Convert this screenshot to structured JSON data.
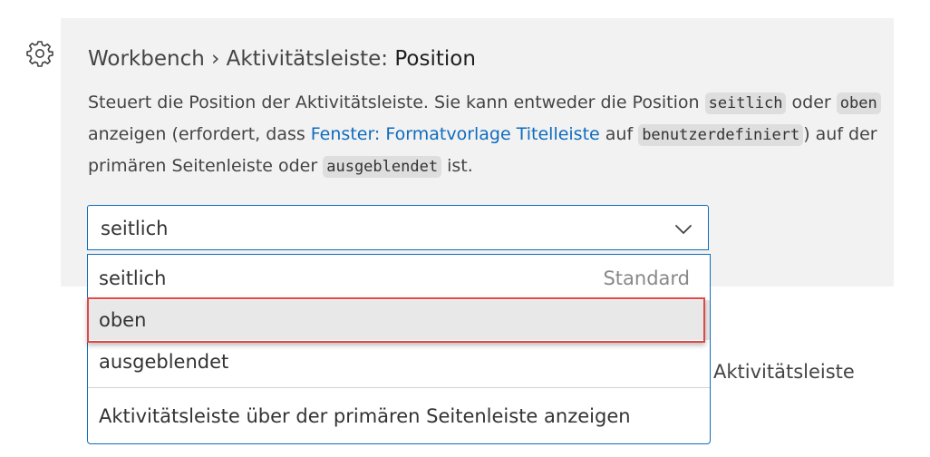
{
  "setting": {
    "category": "Workbench › Aktivitätsleiste: ",
    "name": "Position",
    "description": {
      "part1": "Steuert die Position der Aktivitätsleiste. Sie kann entweder die Position ",
      "code1": "seitlich",
      "part2": " oder ",
      "code2": "oben",
      "part3": " anzeigen (erfordert, dass ",
      "link": "Fenster: Formatvorlage Titelleiste",
      "part4": " auf ",
      "code3": "benutzerdefiniert",
      "part5": ") auf der primären Seitenleiste oder ",
      "code4": "ausgeblendet",
      "part6": " ist."
    }
  },
  "select": {
    "value": "seitlich"
  },
  "dropdown": {
    "options": [
      {
        "label": "seitlich",
        "badge": "Standard"
      },
      {
        "label": "oben"
      },
      {
        "label": "ausgeblendet"
      }
    ],
    "option_description": "Aktivitätsleiste über der primären Seitenleiste anzeigen"
  },
  "background_text": "Aktivitätsleiste",
  "colors": {
    "accent": "#0f6cbd",
    "highlight_border": "#e04848",
    "panel_bg": "#f2f2f2"
  },
  "icons": {
    "settings": "gear-icon",
    "expand": "chevron-down-icon"
  }
}
